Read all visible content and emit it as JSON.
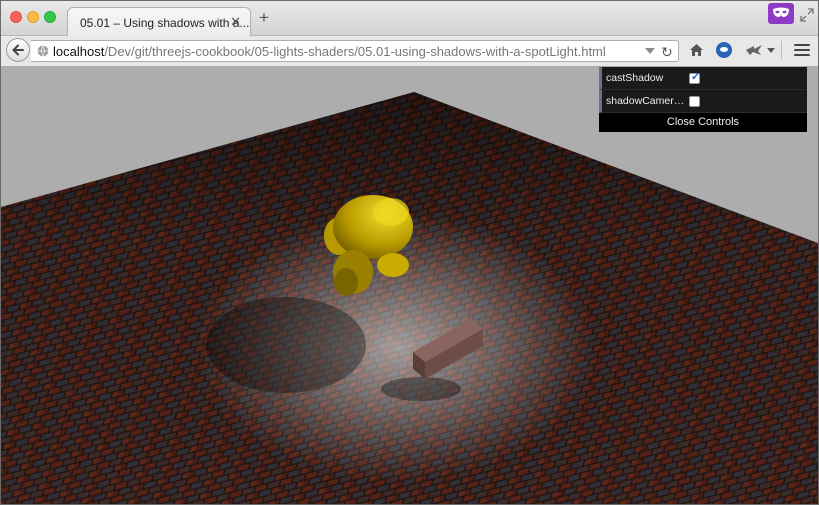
{
  "browser": {
    "tab_title": "05.01 – Using shadows with a...",
    "tab_close": "✕",
    "new_tab": "+",
    "url_host": "localhost",
    "url_path": "/Dev/git/threejs-cookbook/05-lights-shaders/05.01-using-shadows-with-a-spotLight.html",
    "reload": "↻"
  },
  "gui": {
    "controls": [
      {
        "label": "castShadow",
        "checked": true
      },
      {
        "label": "shadowCamera...",
        "checked": false
      }
    ],
    "close_label": "Close Controls"
  },
  "colors": {
    "accent_mask": "#8d3bc4",
    "gui_bg": "#1a1a1a",
    "gui_stripe": "#806787",
    "floor_brick": "#5a2418",
    "monkey": "#d4b400"
  },
  "icons": [
    "back-arrow-icon",
    "globe-icon",
    "dropdown-icon",
    "reload-icon",
    "home-icon",
    "pocket-icon",
    "extension-icon",
    "menu-icon",
    "mask-icon",
    "expand-icon"
  ]
}
